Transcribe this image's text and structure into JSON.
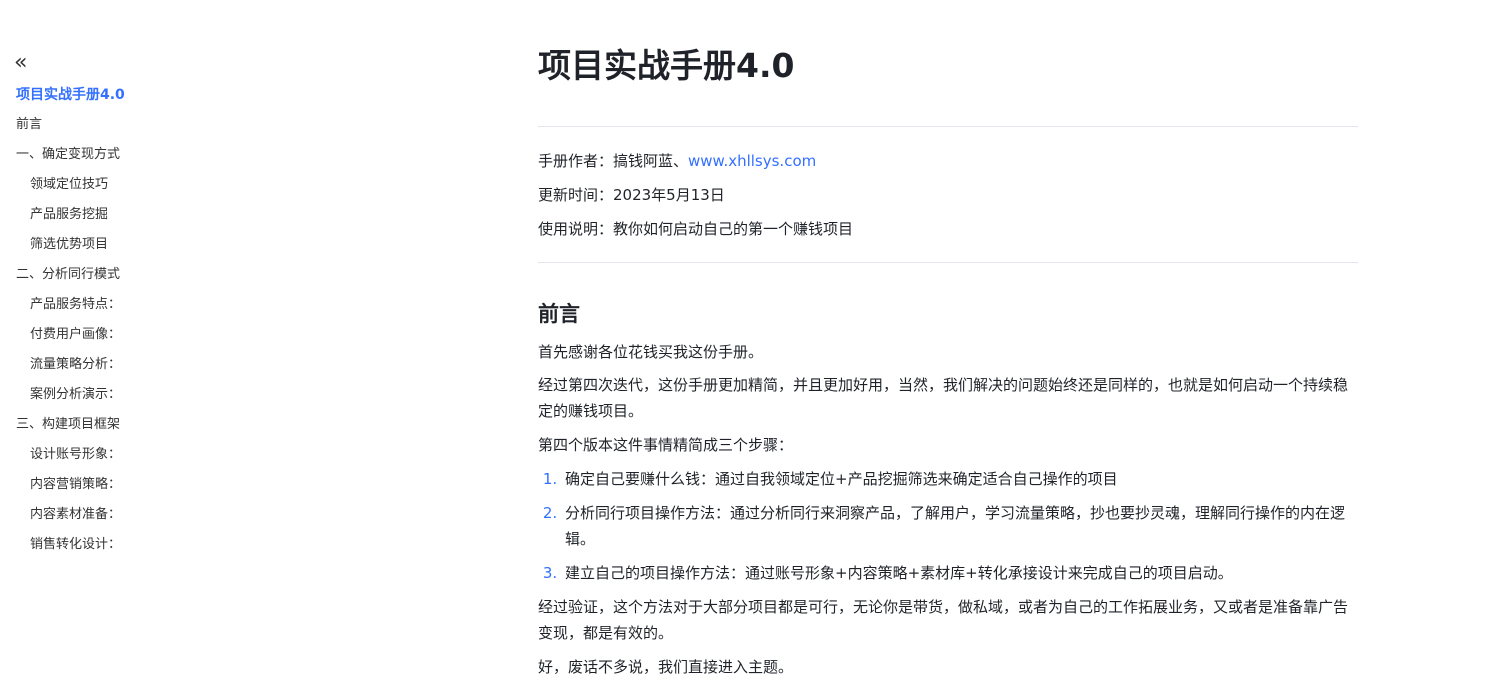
{
  "sidebar": {
    "collapse_glyph": "«",
    "items": [
      {
        "label": "项目实战手册4.0"
      },
      {
        "label": "前言"
      },
      {
        "label": "一、确定变现方式"
      },
      {
        "label": "领域定位技巧"
      },
      {
        "label": "产品服务挖掘"
      },
      {
        "label": "筛选优势项目"
      },
      {
        "label": "二、分析同行模式"
      },
      {
        "label": "产品服务特点："
      },
      {
        "label": "付费用户画像："
      },
      {
        "label": "流量策略分析："
      },
      {
        "label": "案例分析演示："
      },
      {
        "label": "三、构建项目框架"
      },
      {
        "label": "设计账号形象："
      },
      {
        "label": "内容营销策略："
      },
      {
        "label": "内容素材准备："
      },
      {
        "label": "销售转化设计："
      }
    ]
  },
  "doc": {
    "title": "项目实战手册4.0",
    "author_prefix": "手册作者：搞钱阿蓝、",
    "author_link": "www.xhllsys.com",
    "updated": "更新时间：2023年5月13日",
    "usage": "使用说明：教你如何启动自己的第一个赚钱项目",
    "section_heading": "前言",
    "p1": "首先感谢各位花钱买我这份手册。",
    "p2": "经过第四次迭代，这份手册更加精简，并且更加好用，当然，我们解决的问题始终还是同样的，也就是如何启动一个持续稳定的赚钱项目。",
    "p3": "第四个版本这件事情精简成三个步骤：",
    "steps": [
      {
        "num": "1.",
        "text": "确定自己要赚什么钱：通过自我领域定位+产品挖掘筛选来确定适合自己操作的项目"
      },
      {
        "num": "2.",
        "text": "分析同行项目操作方法：通过分析同行来洞察产品，了解用户，学习流量策略，抄也要抄灵魂，理解同行操作的内在逻辑。"
      },
      {
        "num": "3.",
        "text": "建立自己的项目操作方法：通过账号形象+内容策略+素材库+转化承接设计来完成自己的项目启动。"
      }
    ],
    "p4": "经过验证，这个方法对于大部分项目都是可行，无论你是带货，做私域，或者为自己的工作拓展业务，又或者是准备靠广告变现，都是有效的。",
    "p5": "好，废话不多说，我们直接进入主题。"
  },
  "colors": {
    "accent": "#3370ff",
    "text": "#1f2329",
    "divider": "#e5e6eb"
  }
}
